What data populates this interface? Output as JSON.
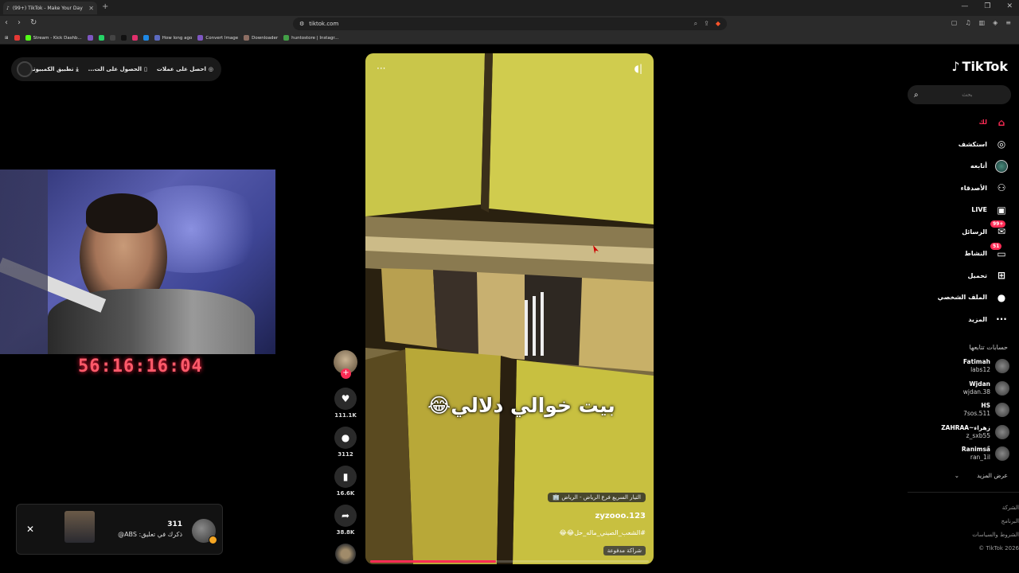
{
  "browser": {
    "tab_title": "(99+) TikTok - Make Your Day",
    "new_tab": "+",
    "url": "tiktok.com",
    "window_controls": [
      "—",
      "❐",
      "✕"
    ],
    "bookmarks": [
      {
        "label": "",
        "color": "#e53935"
      },
      {
        "label": "Stream - Kick Dashb...",
        "color": "#53fc18"
      },
      {
        "label": "",
        "color": "#7e57c2"
      },
      {
        "label": "",
        "color": "#25d366"
      },
      {
        "label": "",
        "color": "#444444"
      },
      {
        "label": "",
        "color": "#111111"
      },
      {
        "label": "",
        "color": "#e1306c"
      },
      {
        "label": "",
        "color": "#1e88e5"
      },
      {
        "label": "How long ago",
        "color": "#5c6bc0"
      },
      {
        "label": "Convert Image",
        "color": "#7e57c2"
      },
      {
        "label": "Downloader",
        "color": "#8d6e63"
      },
      {
        "label": "huntostore | Instagr...",
        "color": "#43a047"
      }
    ]
  },
  "promo": {
    "get_coins": "احصل على عملات",
    "get_app": "الحصول على الت...",
    "desktop_app": "تطبيق الكمبيوتر"
  },
  "stream": {
    "timer": "56:16:16:04"
  },
  "notification": {
    "close": "✕",
    "count": "311",
    "text": "ذكرك في تعليق: ABS@"
  },
  "video": {
    "more_icon": "···",
    "caption": "بيت خوالي دلالي😂",
    "location": "التيار السريع فرع الرياض - الرياض 🏢",
    "username": "zyzooo.123",
    "hashtag": "#الشعب_الصيني_ماله_حل😂😂",
    "sponsored": "شراكة مدفوعة",
    "progress": 0.45
  },
  "actions": {
    "likes": "111.1K",
    "comments": "3112",
    "saves": "16.6K",
    "shares": "38.8K"
  },
  "sidebar": {
    "logo": "TikTok",
    "search_placeholder": "بحث",
    "nav": [
      {
        "label": "لك",
        "icon": "home-icon",
        "active": true
      },
      {
        "label": "استكشف",
        "icon": "compass-icon"
      },
      {
        "label": "أتابعه",
        "icon": "following-avatar"
      },
      {
        "label": "الأصدقاء",
        "icon": "friends-icon"
      },
      {
        "label": "LIVE",
        "icon": "live-icon"
      },
      {
        "label": "الرسائل",
        "icon": "messages-icon",
        "badge": "99+"
      },
      {
        "label": "النشاط",
        "icon": "activity-icon",
        "badge": "51"
      },
      {
        "label": "تحميل",
        "icon": "upload-icon"
      },
      {
        "label": "الملف الشخصي",
        "icon": "profile-icon"
      },
      {
        "label": "المزيد",
        "icon": "more-icon"
      }
    ],
    "accounts_title": "حسابات تتابعها",
    "accounts": [
      {
        "name": "Fatimah",
        "handle": "labs12"
      },
      {
        "name": "Wjdan",
        "handle": "wjdan.38"
      },
      {
        "name": "HS",
        "handle": "7sos.511"
      },
      {
        "name": "ZAHRAA~زهراء",
        "handle": "z_sxb55"
      },
      {
        "name": "Ranimsa̋",
        "handle": "ran_1il"
      }
    ],
    "see_more": "عرض المزيد",
    "footer": [
      "الشركة",
      "البرنامج",
      "الشروط والسياسات",
      "TikTok 2026 ©"
    ]
  }
}
